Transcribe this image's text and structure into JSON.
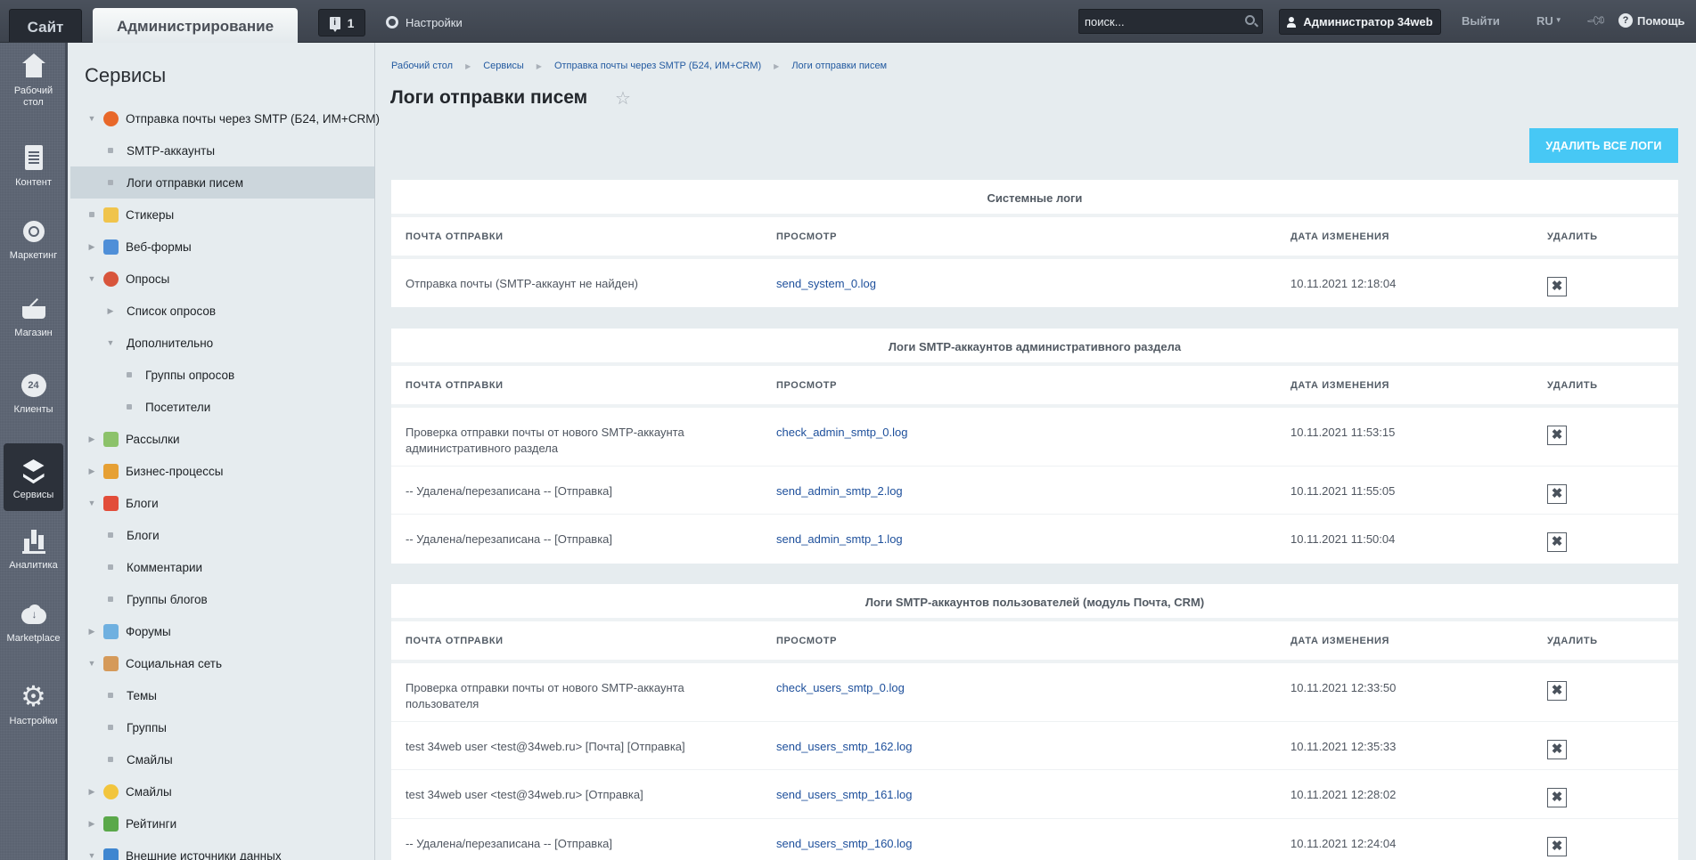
{
  "topbar": {
    "site_tab": "Сайт",
    "admin_tab": "Администрирование",
    "notifications_count": "1",
    "settings_label": "Настройки",
    "search_placeholder": "поиск...",
    "user_label": "Администратор 34web",
    "logout_label": "Выйти",
    "language": "RU",
    "help_label": "Помощь"
  },
  "rail": {
    "items": [
      {
        "label": "Рабочий стол",
        "icon": "home-icon"
      },
      {
        "label": "Контент",
        "icon": "document-icon"
      },
      {
        "label": "Маркетинг",
        "icon": "target-icon"
      },
      {
        "label": "Магазин",
        "icon": "basket-icon"
      },
      {
        "label": "Клиенты",
        "icon": "clients-24-icon"
      },
      {
        "label": "Сервисы",
        "icon": "layers-icon",
        "active": true
      },
      {
        "label": "Аналитика",
        "icon": "bar-chart-icon"
      },
      {
        "label": "Marketplace",
        "icon": "cloud-download-icon"
      },
      {
        "label": "Настройки",
        "icon": "gear-icon"
      }
    ]
  },
  "tree": {
    "title": "Сервисы",
    "items": [
      {
        "label": "Отправка почты через SMTP (Б24, ИМ+CRM)",
        "level": 0,
        "toggle": "expanded",
        "icon": "mail-smtp-icon",
        "icon_color": "#e8682a"
      },
      {
        "label": "SMTP-аккаунты",
        "level": 1,
        "toggle": "leaf"
      },
      {
        "label": "Логи отправки писем",
        "level": 1,
        "toggle": "leaf",
        "active": true
      },
      {
        "label": "Стикеры",
        "level": 0,
        "toggle": "leaf",
        "icon": "stickers-icon",
        "icon_color": "#f0c44c"
      },
      {
        "label": "Веб-формы",
        "level": 0,
        "toggle": "collapsed",
        "icon": "web-forms-icon",
        "icon_color": "#4f8fd8"
      },
      {
        "label": "Опросы",
        "level": 0,
        "toggle": "expanded",
        "icon": "polls-icon",
        "icon_color": "#d8553c"
      },
      {
        "label": "Список опросов",
        "level": 1,
        "toggle": "collapsed"
      },
      {
        "label": "Дополнительно",
        "level": 1,
        "toggle": "expanded"
      },
      {
        "label": "Группы опросов",
        "level": 2,
        "toggle": "leaf"
      },
      {
        "label": "Посетители",
        "level": 2,
        "toggle": "leaf"
      },
      {
        "label": "Рассылки",
        "level": 0,
        "toggle": "collapsed",
        "icon": "mailing-icon",
        "icon_color": "#8cc26a"
      },
      {
        "label": "Бизнес-процессы",
        "level": 0,
        "toggle": "collapsed",
        "icon": "business-process-icon",
        "icon_color": "#e6a034"
      },
      {
        "label": "Блоги",
        "level": 0,
        "toggle": "expanded",
        "icon": "blogs-icon",
        "icon_color": "#e24d3a"
      },
      {
        "label": "Блоги",
        "level": 1,
        "toggle": "leaf"
      },
      {
        "label": "Комментарии",
        "level": 1,
        "toggle": "leaf"
      },
      {
        "label": "Группы блогов",
        "level": 1,
        "toggle": "leaf"
      },
      {
        "label": "Форумы",
        "level": 0,
        "toggle": "collapsed",
        "icon": "forums-icon",
        "icon_color": "#6fb0e0"
      },
      {
        "label": "Социальная сеть",
        "level": 0,
        "toggle": "expanded",
        "icon": "social-network-icon",
        "icon_color": "#d59a5a"
      },
      {
        "label": "Темы",
        "level": 1,
        "toggle": "leaf"
      },
      {
        "label": "Группы",
        "level": 1,
        "toggle": "leaf"
      },
      {
        "label": "Смайлы",
        "level": 1,
        "toggle": "leaf"
      },
      {
        "label": "Смайлы",
        "level": 0,
        "toggle": "collapsed",
        "icon": "smiles-icon",
        "icon_color": "#f2c53d"
      },
      {
        "label": "Рейтинги",
        "level": 0,
        "toggle": "collapsed",
        "icon": "ratings-icon",
        "icon_color": "#5aa84a"
      },
      {
        "label": "Внешние источники данных",
        "level": 0,
        "toggle": "expanded",
        "icon": "rss-icon",
        "icon_color": "#3f86d0"
      }
    ]
  },
  "main": {
    "breadcrumbs": [
      "Рабочий стол",
      "Сервисы",
      "Отправка почты через SMTP (Б24, ИМ+CRM)",
      "Логи отправки писем"
    ],
    "title": "Логи отправки писем",
    "delete_all_label": "УДАЛИТЬ ВСЕ ЛОГИ",
    "columns": [
      "ПОЧТА ОТПРАВКИ",
      "ПРОСМОТР",
      "ДАТА ИЗМЕНЕНИЯ",
      "УДАЛИТЬ"
    ],
    "sections": [
      {
        "title": "Системные логи",
        "rows": [
          {
            "mail": "Отправка почты (SMTP-аккаунт не найден)",
            "file": "send_system_0.log",
            "date": "10.11.2021 12:18:04"
          }
        ]
      },
      {
        "title": "Логи SMTP-аккаунтов административного раздела",
        "rows": [
          {
            "mail": "Проверка отправки почты от нового SMTP-аккаунта административного раздела",
            "file": "check_admin_smtp_0.log",
            "date": "10.11.2021 11:53:15"
          },
          {
            "mail": "-- Удалена/перезаписана -- [Отправка]",
            "file": "send_admin_smtp_2.log",
            "date": "10.11.2021 11:55:05"
          },
          {
            "mail": "-- Удалена/перезаписана -- [Отправка]",
            "file": "send_admin_smtp_1.log",
            "date": "10.11.2021 11:50:04"
          }
        ]
      },
      {
        "title": "Логи SMTP-аккаунтов пользователей (модуль Почта, CRM)",
        "rows": [
          {
            "mail": "Проверка отправки почты от нового SMTP-аккаунта пользователя",
            "file": "check_users_smtp_0.log",
            "date": "10.11.2021 12:33:50"
          },
          {
            "mail": "test 34web user <test@34web.ru> [Почта] [Отправка]",
            "file": "send_users_smtp_162.log",
            "date": "10.11.2021 12:35:33"
          },
          {
            "mail": "test 34web user <test@34web.ru> [Отправка]",
            "file": "send_users_smtp_161.log",
            "date": "10.11.2021 12:28:02"
          },
          {
            "mail": "-- Удалена/перезаписана -- [Отправка]",
            "file": "send_users_smtp_160.log",
            "date": "10.11.2021 12:24:04"
          }
        ]
      }
    ],
    "delete_glyph": "✖"
  },
  "colors": {
    "accent_button": "#47c8f5",
    "link": "#1d4f9b",
    "topbar": "#434a55",
    "rail": "#5b6371"
  }
}
